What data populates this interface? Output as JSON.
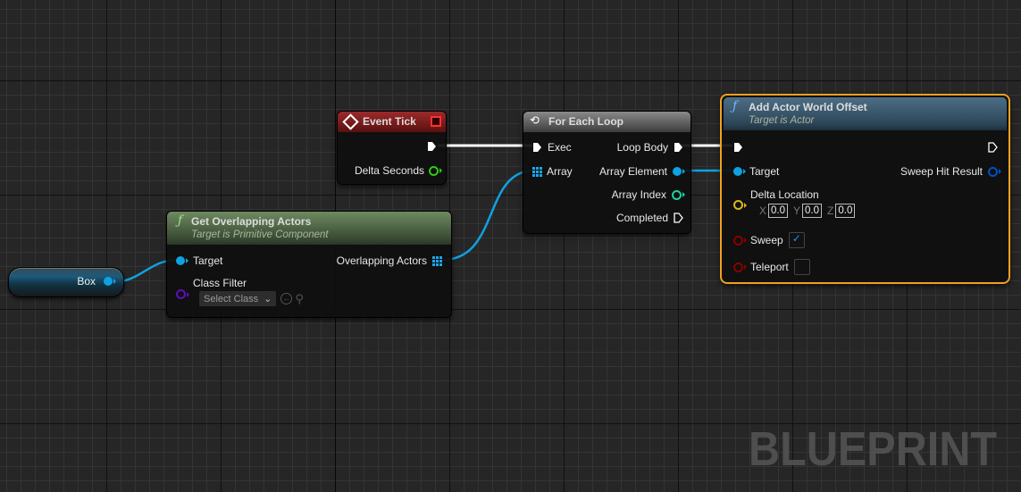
{
  "graph": {
    "watermark": "BLUEPRINT",
    "colors": {
      "exec_wire": "#ffffff",
      "object_wire": "#0fa1e0",
      "float_pin": "#35c818",
      "int_pin": "#1ed0a0",
      "vector_pin": "#e0b51c",
      "bool_pin": "#8a0000",
      "class_pin": "#5a10c0",
      "struct_pin": "#0050c8",
      "selected_outline": "#f0a020"
    }
  },
  "nodes": {
    "box": {
      "label": "Box"
    },
    "event_tick": {
      "title": "Event Tick",
      "outputs": {
        "delta_seconds": "Delta Seconds"
      }
    },
    "for_each_loop": {
      "title": "For Each Loop",
      "inputs": {
        "exec": "Exec",
        "array": "Array"
      },
      "outputs": {
        "loop_body": "Loop Body",
        "array_element": "Array Element",
        "array_index": "Array Index",
        "completed": "Completed"
      }
    },
    "get_overlapping_actors": {
      "title": "Get Overlapping Actors",
      "subtitle": "Target is Primitive Component",
      "inputs": {
        "target": "Target",
        "class_filter": "Class Filter",
        "class_select": "Select Class"
      },
      "outputs": {
        "overlapping_actors": "Overlapping Actors"
      }
    },
    "add_actor_world_offset": {
      "title": "Add Actor World Offset",
      "subtitle": "Target is Actor",
      "inputs": {
        "target": "Target",
        "delta_location": "Delta Location",
        "x_label": "X",
        "x": "0.0",
        "y_label": "Y",
        "y": "0.0",
        "z_label": "Z",
        "z": "0.0",
        "sweep": "Sweep",
        "sweep_checked": true,
        "teleport": "Teleport",
        "teleport_checked": false
      },
      "outputs": {
        "sweep_hit_result": "Sweep Hit Result"
      }
    }
  }
}
